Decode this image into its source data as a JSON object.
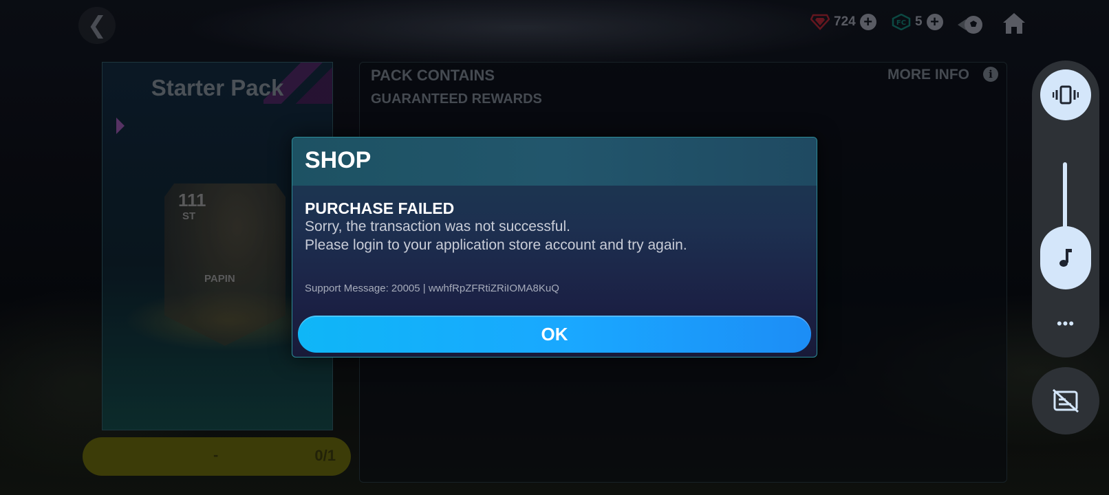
{
  "top_bar": {
    "back_glyph": "❮",
    "gems_count": "724",
    "tokens_count": "5",
    "plus_glyph": "+"
  },
  "pack": {
    "title": "Starter Pack",
    "card": {
      "rating": "111",
      "position": "ST",
      "name": "PAPIN"
    },
    "progress_dash": "-",
    "progress_count": "0/1"
  },
  "contents_panel": {
    "title": "PACK CONTAINS",
    "subtitle": "GUARANTEED REWARDS",
    "more_info_label": "MORE INFO",
    "info_glyph": "i"
  },
  "dialog": {
    "title": "SHOP",
    "heading": "PURCHASE FAILED",
    "line1": "Sorry, the transaction was not successful.",
    "line2": "Please login to your application store account and try again.",
    "support_message": "Support Message: 20005 | wwhfRpZFRtiZRiIOMA8KuQ",
    "ok_label": "OK"
  },
  "side_controls": {
    "more_glyph": "•••"
  },
  "colors": {
    "ok_button": "#1aa7ff",
    "dialog_border": "#2c8c98",
    "side_accent": "#d4e6fa"
  }
}
